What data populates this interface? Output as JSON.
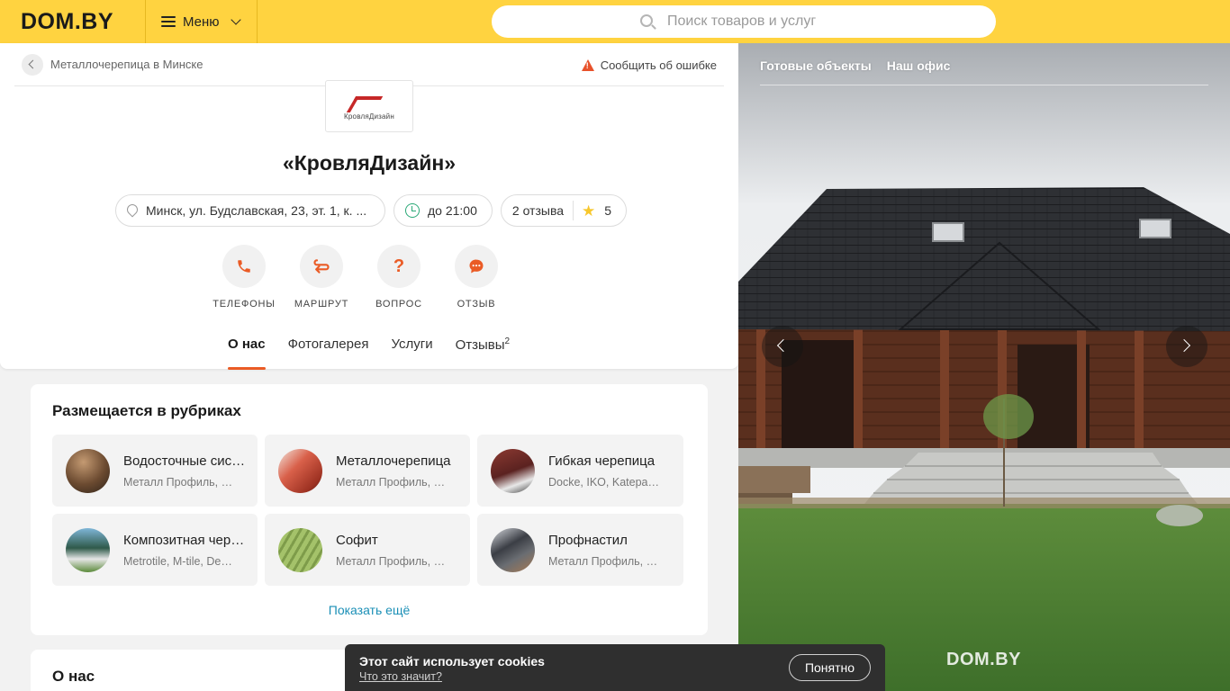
{
  "header": {
    "logo": "DOM.BY",
    "menu_label": "Меню",
    "search_placeholder": "Поиск товаров и услуг"
  },
  "breadcrumb": {
    "text": "Металлочерепица в Минске",
    "report": "Сообщить об ошибке"
  },
  "company": {
    "logo_text": "КровляДизайн",
    "title": "«КровляДизайн»",
    "address": "Минск, ул. Будславская, 23, эт. 1, к. ...",
    "hours": "до 21:00",
    "reviews": "2 отзыва",
    "rating": "5"
  },
  "actions": [
    {
      "label": "ТЕЛЕФОНЫ",
      "icon": "phone-icon"
    },
    {
      "label": "МАРШРУТ",
      "icon": "route-icon"
    },
    {
      "label": "ВОПРОС",
      "icon": "question-icon"
    },
    {
      "label": "ОТЗЫВ",
      "icon": "chat-icon"
    }
  ],
  "tabs": [
    {
      "label": "О нас",
      "active": true
    },
    {
      "label": "Фотогалерея"
    },
    {
      "label": "Услуги"
    },
    {
      "label": "Отзывы",
      "sup": "2"
    }
  ],
  "rubrics": {
    "title": "Размещается в рубриках",
    "items": [
      {
        "name": "Водосточные системы",
        "sub": "Металл Профиль, Galeco"
      },
      {
        "name": "Металлочерепица",
        "sub": "Металл Профиль, Ruukki"
      },
      {
        "name": "Гибкая черепица",
        "sub": "Docke, IKO, Katepal, Shinglas"
      },
      {
        "name": "Композитная черепица",
        "sub": "Metrotile, M-tile, Decra"
      },
      {
        "name": "Софит",
        "sub": "Металл Профиль, Docke"
      },
      {
        "name": "Профнастил",
        "sub": "Металл Профиль, Ruukki"
      }
    ],
    "show_more": "Показать ещё"
  },
  "about": {
    "title": "О нас"
  },
  "photo": {
    "nav": [
      "Готовые объекты",
      "Наш офис"
    ],
    "watermark": "DOM.BY"
  },
  "cookie": {
    "title": "Этот сайт использует cookies",
    "link": "Что это значит?",
    "button": "Понятно"
  },
  "colors": {
    "header_bg": "#ffd340",
    "accent": "#ea5b25",
    "link": "#1a8fb6",
    "open_green": "#2aa876"
  }
}
